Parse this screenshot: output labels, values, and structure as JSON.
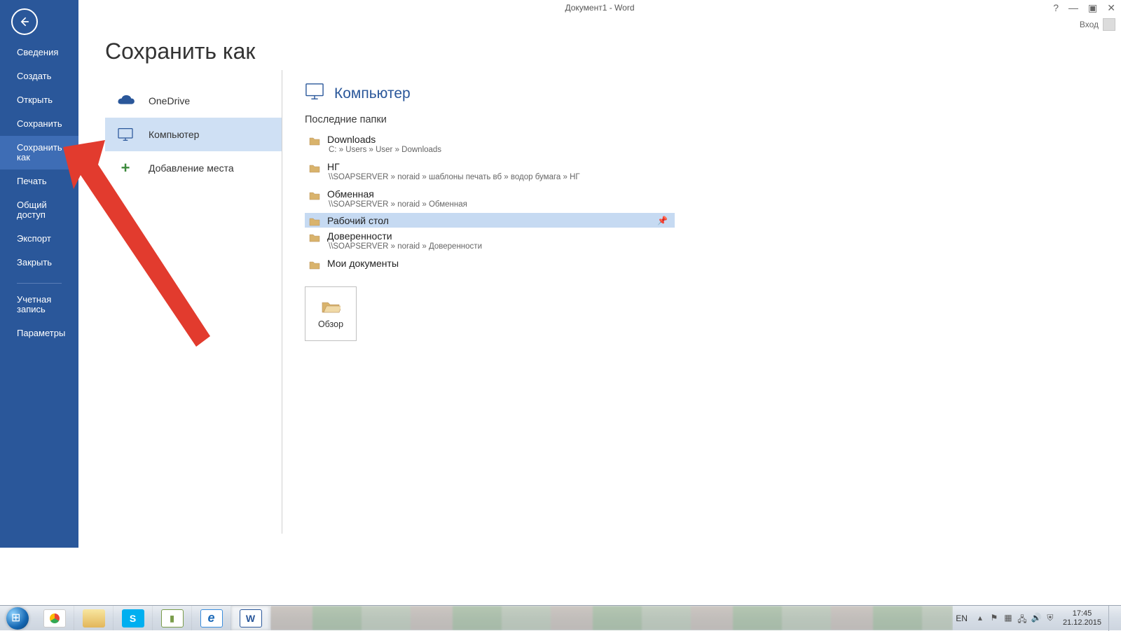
{
  "window": {
    "title": "Документ1 - Word",
    "signin": "Вход"
  },
  "sidebar": {
    "items": [
      {
        "label": "Сведения"
      },
      {
        "label": "Создать"
      },
      {
        "label": "Открыть"
      },
      {
        "label": "Сохранить"
      },
      {
        "label": "Сохранить как",
        "selected": true
      },
      {
        "label": "Печать"
      },
      {
        "label": "Общий доступ"
      },
      {
        "label": "Экспорт"
      },
      {
        "label": "Закрыть"
      }
    ],
    "items2": [
      {
        "label": "Учетная запись"
      },
      {
        "label": "Параметры"
      }
    ]
  },
  "page": {
    "title": "Сохранить как"
  },
  "places": {
    "onedrive": "OneDrive",
    "computer": "Компьютер",
    "add": "Добавление места"
  },
  "right": {
    "header": "Компьютер",
    "subhead": "Последние папки",
    "folders": [
      {
        "name": "Downloads",
        "path": "C: » Users » User » Downloads"
      },
      {
        "name": "НГ",
        "path": "\\\\SOAPSERVER » noraid » шаблоны печать вб » водор бумага » НГ"
      },
      {
        "name": "Обменная",
        "path": "\\\\SOAPSERVER » noraid » Обменная"
      },
      {
        "name": "Рабочий стол",
        "path": "",
        "selected": true
      },
      {
        "name": "Доверенности",
        "path": "\\\\SOAPSERVER » noraid » Доверенности"
      },
      {
        "name": "Мои документы",
        "path": ""
      }
    ],
    "browse": "Обзор"
  },
  "taskbar": {
    "lang": "EN",
    "time": "17:45",
    "date": "21.12.2015"
  }
}
